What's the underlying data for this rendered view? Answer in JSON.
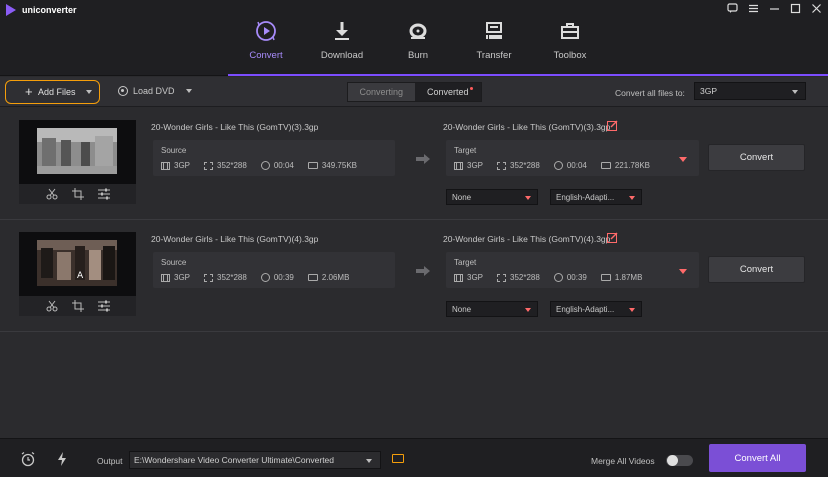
{
  "app": {
    "name": "uniconverter",
    "accent_color": "#8b5cf6",
    "highlight_color": "#f59e0b"
  },
  "window_controls": [
    "feedback-icon",
    "menu-icon",
    "minimize-icon",
    "maximize-icon",
    "close-icon"
  ],
  "nav": {
    "tabs": [
      {
        "label": "Convert",
        "icon": "convert-icon",
        "active": true
      },
      {
        "label": "Download",
        "icon": "download-icon",
        "active": false
      },
      {
        "label": "Burn",
        "icon": "burn-icon",
        "active": false
      },
      {
        "label": "Transfer",
        "icon": "transfer-icon",
        "active": false
      },
      {
        "label": "Toolbox",
        "icon": "toolbox-icon",
        "active": false
      }
    ]
  },
  "toolbar": {
    "add_files_label": "Add Files",
    "load_dvd_label": "Load DVD",
    "segments": {
      "converting": "Converting",
      "converted": "Converted"
    },
    "convert_all_label": "Convert all files to:",
    "convert_all_value": "3GP"
  },
  "items": [
    {
      "source_name": "20-Wonder Girls - Like This (GomTV)(3).3gp",
      "target_name": "20-Wonder Girls - Like This (GomTV)(3).3gp",
      "source": {
        "label": "Source",
        "format": "3GP",
        "resolution": "352*288",
        "duration": "00:04",
        "size": "349.75KB"
      },
      "target": {
        "label": "Target",
        "format": "3GP",
        "resolution": "352*288",
        "duration": "00:04",
        "size": "221.78KB"
      },
      "subtitle": "None",
      "audio": "English-Adapti...",
      "convert_label": "Convert"
    },
    {
      "source_name": "20-Wonder Girls - Like This (GomTV)(4).3gp",
      "target_name": "20-Wonder Girls - Like This (GomTV)(4).3gp",
      "source": {
        "label": "Source",
        "format": "3GP",
        "resolution": "352*288",
        "duration": "00:39",
        "size": "2.06MB"
      },
      "target": {
        "label": "Target",
        "format": "3GP",
        "resolution": "352*288",
        "duration": "00:39",
        "size": "1.87MB"
      },
      "subtitle": "None",
      "audio": "English-Adapti...",
      "convert_label": "Convert"
    }
  ],
  "bottom": {
    "output_label": "Output",
    "output_path": "E:\\Wondershare Video Converter Ultimate\\Converted",
    "merge_label": "Merge All Videos",
    "merge_enabled": false,
    "convert_all_button": "Convert All"
  }
}
